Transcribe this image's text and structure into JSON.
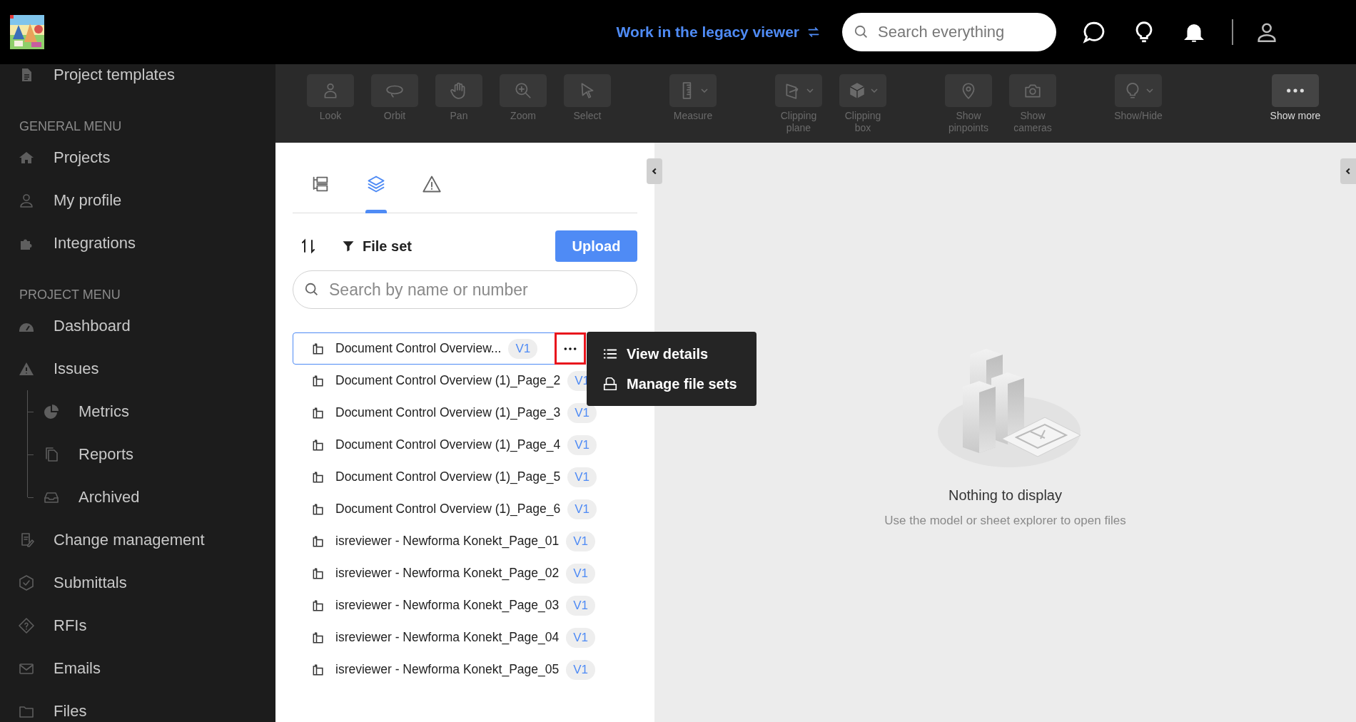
{
  "header": {
    "link": "Work in the legacy viewer",
    "search": {
      "placeholder": "Search everything"
    }
  },
  "sidebar": {
    "top": [
      {
        "label": "Project templates"
      }
    ],
    "sections": [
      {
        "heading": "GENERAL MENU",
        "items": [
          {
            "label": "Projects"
          },
          {
            "label": "My profile"
          },
          {
            "label": "Integrations"
          }
        ]
      },
      {
        "heading": "PROJECT MENU",
        "items": [
          {
            "label": "Dashboard"
          },
          {
            "label": "Issues",
            "children": [
              {
                "label": "Metrics"
              },
              {
                "label": "Reports"
              },
              {
                "label": "Archived"
              }
            ]
          },
          {
            "label": "Change management"
          },
          {
            "label": "Submittals"
          },
          {
            "label": "RFIs"
          },
          {
            "label": "Emails"
          },
          {
            "label": "Files"
          }
        ]
      }
    ]
  },
  "toolbar": {
    "groups": [
      {
        "tools": [
          {
            "label": "Look",
            "disabled": true,
            "dropdown": false
          },
          {
            "label": "Orbit",
            "disabled": true,
            "dropdown": false
          },
          {
            "label": "Pan",
            "disabled": true,
            "dropdown": false
          },
          {
            "label": "Zoom",
            "disabled": true,
            "dropdown": false
          },
          {
            "label": "Select",
            "disabled": true,
            "dropdown": false
          }
        ]
      },
      {
        "tools": [
          {
            "label": "Measure",
            "disabled": true,
            "dropdown": true
          }
        ]
      },
      {
        "tools": [
          {
            "label": "Clipping plane",
            "disabled": true,
            "dropdown": true
          },
          {
            "label": "Clipping box",
            "disabled": true,
            "dropdown": true
          }
        ]
      },
      {
        "tools": [
          {
            "label": "Show pinpoints",
            "disabled": true,
            "dropdown": false
          },
          {
            "label": "Show cameras",
            "disabled": true,
            "dropdown": false
          }
        ]
      },
      {
        "tools": [
          {
            "label": "Show/Hide",
            "disabled": true,
            "dropdown": true
          }
        ]
      }
    ],
    "more": {
      "label": "Show more",
      "disabled": false
    }
  },
  "panel": {
    "tabs": [
      {
        "selected": false
      },
      {
        "selected": true
      },
      {
        "selected": false
      }
    ],
    "filter": "File set",
    "upload": "Upload",
    "search": {
      "placeholder": "Search by name or number"
    },
    "files": [
      {
        "name": "Document Control Overview...",
        "version": "V1",
        "selected": true
      },
      {
        "name": "Document Control Overview (1)_Page_2",
        "version": "V1",
        "selected": false
      },
      {
        "name": "Document Control Overview (1)_Page_3",
        "version": "V1",
        "selected": false
      },
      {
        "name": "Document Control Overview (1)_Page_4",
        "version": "V1",
        "selected": false
      },
      {
        "name": "Document Control Overview (1)_Page_5",
        "version": "V1",
        "selected": false
      },
      {
        "name": "Document Control Overview (1)_Page_6",
        "version": "V1",
        "selected": false
      },
      {
        "name": "isreviewer - Newforma Konekt_Page_01",
        "version": "V1",
        "selected": false
      },
      {
        "name": "isreviewer - Newforma Konekt_Page_02",
        "version": "V1",
        "selected": false
      },
      {
        "name": "isreviewer - Newforma Konekt_Page_03",
        "version": "V1",
        "selected": false
      },
      {
        "name": "isreviewer - Newforma Konekt_Page_04",
        "version": "V1",
        "selected": false
      },
      {
        "name": "isreviewer - Newforma Konekt_Page_05",
        "version": "V1",
        "selected": false
      }
    ],
    "more_highlighted": true,
    "menu": {
      "items": [
        {
          "label": "View details"
        },
        {
          "label": "Manage file sets"
        }
      ]
    }
  },
  "viewer": {
    "title": "Nothing to display",
    "subtitle": "Use the model or sheet explorer to open files"
  }
}
